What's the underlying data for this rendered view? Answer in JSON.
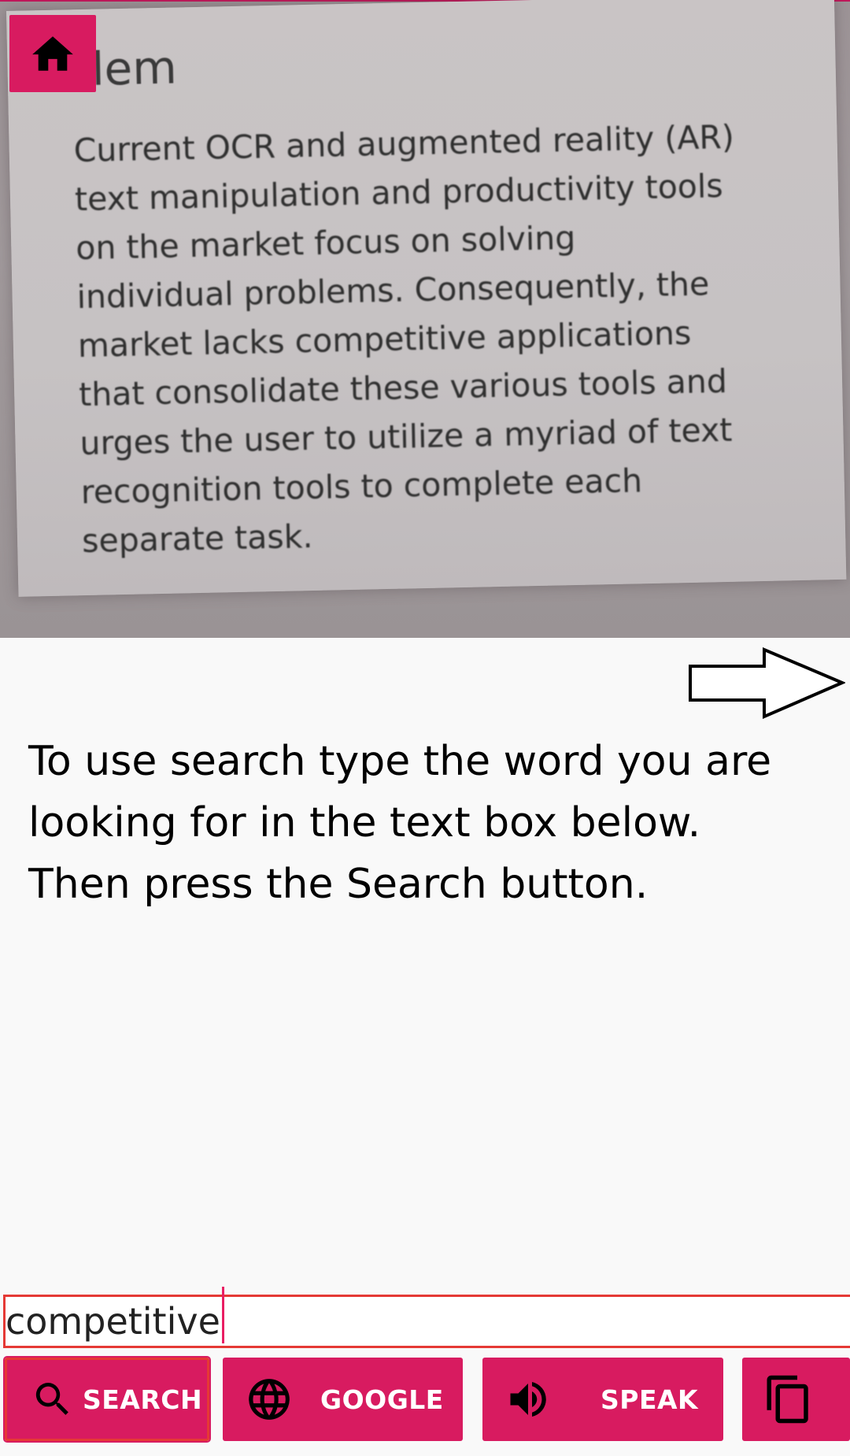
{
  "camera": {
    "visible_title": "blem",
    "visible_body": "Current OCR and augmented reality (AR)\ntext manipulation and productivity tools\non the market focus on solving\nindividual problems.  Consequently, the\nmarket lacks competitive applications\nthat consolidate these various tools and\nurges the user to utilize a myriad of text\nrecognition tools to complete each\nseparate task."
  },
  "toolbar": {
    "home_icon": "home-icon",
    "next_icon": "arrow-right-icon"
  },
  "instructions": "To use search type the word you are\nlooking for in the text box below.\nThen press the Search button.",
  "search": {
    "value": "competitive"
  },
  "buttons": {
    "search": {
      "label": "SEARCH",
      "icon": "search-icon"
    },
    "google": {
      "label": "GOOGLE",
      "icon": "globe-icon"
    },
    "speak": {
      "label": "SPEAK",
      "icon": "speaker-icon"
    },
    "copy": {
      "label": "",
      "icon": "copy-icon"
    }
  },
  "colors": {
    "accent": "#d81b60",
    "highlight_border": "#e53935",
    "background": "#f9f9f9"
  }
}
